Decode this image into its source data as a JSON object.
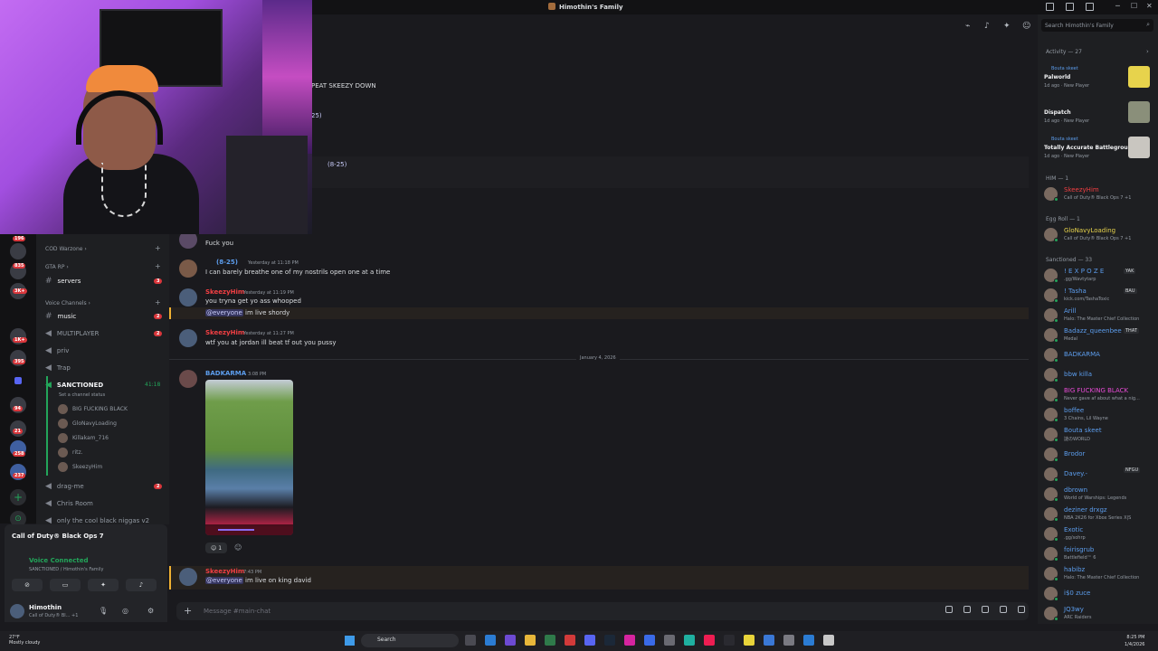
{
  "window": {
    "title": "Himothin's Family"
  },
  "header_text": {
    "line1": "PEAT SKEEZY DOWN",
    "line2": "25)",
    "line3": "(8-25)"
  },
  "server_rail": {
    "badges": [
      "196",
      "835",
      "3K+",
      "1K+",
      "395",
      "94",
      "21",
      "258",
      "237"
    ]
  },
  "channels": {
    "items": [
      {
        "label": "COD Warzone",
        "kind": "category"
      },
      {
        "label": "GTA RP",
        "kind": "category"
      },
      {
        "label": "servers",
        "kind": "text",
        "badge": "3"
      },
      {
        "label": "Voice Channels",
        "kind": "category"
      },
      {
        "label": "music",
        "kind": "text",
        "badge": "2"
      },
      {
        "label": "MULTIPLAYER",
        "kind": "voice",
        "badge": "2"
      },
      {
        "label": "priv",
        "kind": "voice"
      },
      {
        "label": "Trap",
        "kind": "voice"
      },
      {
        "label": "SANCTIONED",
        "kind": "voice",
        "timer": "41:18"
      },
      {
        "label": "drag-me",
        "kind": "voice",
        "badge": "2"
      },
      {
        "label": "Chris Room",
        "kind": "voice"
      },
      {
        "label": "only the cool black niggas v2",
        "kind": "voice"
      }
    ],
    "channel_status": "Set a channel status",
    "voice_users": [
      "BIG FUCKING BLACK",
      "GloNavyLoading",
      "Killakam_716",
      "ritz.",
      "SkeezyHim"
    ]
  },
  "voice_panel": {
    "game": "Call of Duty® Black Ops 7",
    "status": "Voice Connected",
    "location": "SANCTIONED / Himothin's Family",
    "user_name": "Himothin",
    "user_status": "Call of Duty® Bl...",
    "user_extra": "+1"
  },
  "messages": [
    {
      "author": "",
      "time": "",
      "text": "Fuck you"
    },
    {
      "author": "(8-25)",
      "time": "Yesterday at 11:18 PM",
      "text": "I can barely breathe one of my nostrils open one at a time"
    },
    {
      "author": "SkeezyHim",
      "time": "Yesterday at 11:19 PM",
      "text": "you tryna get yo ass whooped",
      "mention": "@everyone",
      "text2": "im live shordy"
    },
    {
      "author": "SkeezyHim",
      "time": "Yesterday at 11:27 PM",
      "text": "wtf you at jordan ill beat tf out you pussy"
    },
    {
      "author": "BADKARMA",
      "time": "3:08 PM",
      "reaction_count": "1"
    },
    {
      "author": "SkeezyHim",
      "time": "7:43 PM",
      "mention": "@everyone",
      "text": "im live on king david"
    }
  ],
  "date_divider": "January 4, 2026",
  "composer": {
    "placeholder": "Message #main-chat"
  },
  "right_panel": {
    "search_placeholder": "Search Himothin's Family",
    "activity_header": "Activity — 27",
    "activities": [
      {
        "who": "Bouta skeet",
        "game": "Palworld",
        "meta": "1d ago",
        "tag": "New Player",
        "color": "#e7d34c"
      },
      {
        "who": "",
        "game": "Dispatch",
        "meta": "1d ago",
        "tag": "New Player",
        "color": "#8a8f7a"
      },
      {
        "who": "Bouta skeet",
        "game": "Totally Accurate Battlegrou...",
        "meta": "1d ago",
        "tag": "New Player",
        "color": "#c9c6c0"
      }
    ],
    "groups": [
      {
        "header": "HIM — 1",
        "members": [
          {
            "name": "SkeezyHim",
            "activity": "Call of Duty® Black Ops 7 +1",
            "color": "#f23f43"
          }
        ]
      },
      {
        "header": "Egg Roll — 1",
        "members": [
          {
            "name": "GloNavyLoading",
            "activity": "Call of Duty® Black Ops 7 +1",
            "color": "#e7d34c"
          }
        ]
      },
      {
        "header": "Sanctioned — 33",
        "members": [
          {
            "name": "! E X P O Z E",
            "activity": ".gg/Wavtytarp",
            "color": "#5c9ded",
            "tag": "YAK"
          },
          {
            "name": "! Tasha",
            "activity": "kick.com/TashaToxic",
            "color": "#5c9ded",
            "tag": "BAU"
          },
          {
            "name": "Arill",
            "activity": "Halo: The Master Chief Collection",
            "color": "#5c9ded"
          },
          {
            "name": "Badazz_queenbee",
            "activity": "Medal",
            "color": "#5c9ded",
            "tag": "THAT"
          },
          {
            "name": "BADKARMA",
            "activity": "",
            "color": "#5c9ded"
          },
          {
            "name": "bbw killa",
            "activity": "",
            "color": "#5c9ded"
          },
          {
            "name": "BIG FUCKING BLACK",
            "activity": "Never gave af about what a nig...",
            "color": "#e84bd6"
          },
          {
            "name": "boffee",
            "activity": "3 Chains, Lil Wayne",
            "color": "#5c9ded"
          },
          {
            "name": "Bouta skeet",
            "activity": "謎のWORLD",
            "color": "#5c9ded"
          },
          {
            "name": "Brodor",
            "activity": "",
            "color": "#5c9ded"
          },
          {
            "name": "Davey.-",
            "activity": "",
            "color": "#5c9ded",
            "tag": "NFGU"
          },
          {
            "name": "dbrown",
            "activity": "World of Warships: Legends",
            "color": "#5c9ded"
          },
          {
            "name": "deziner drxgz",
            "activity": "NBA 2K26 for Xbox Series X|S",
            "color": "#5c9ded"
          },
          {
            "name": "Exotic",
            "activity": ".gg/sohrp",
            "color": "#5c9ded"
          },
          {
            "name": "foirisgrub",
            "activity": "Battlefield™ 6",
            "color": "#5c9ded"
          },
          {
            "name": "habibz",
            "activity": "Halo: The Master Chief Collection",
            "color": "#5c9ded"
          },
          {
            "name": "i$0 zuce",
            "activity": "",
            "color": "#5c9ded"
          },
          {
            "name": "JQ3wy",
            "activity": "ARC Raiders",
            "color": "#5c9ded"
          }
        ]
      }
    ]
  },
  "taskbar": {
    "weather_temp": "27°F",
    "weather_desc": "Mostly cloudy",
    "search": "Search",
    "time": "8:25 PM",
    "date": "1/4/2026"
  },
  "colors": {
    "accent": "#5865f2",
    "online": "#23a55a",
    "mention": "#f0b132",
    "danger": "#da373c"
  }
}
